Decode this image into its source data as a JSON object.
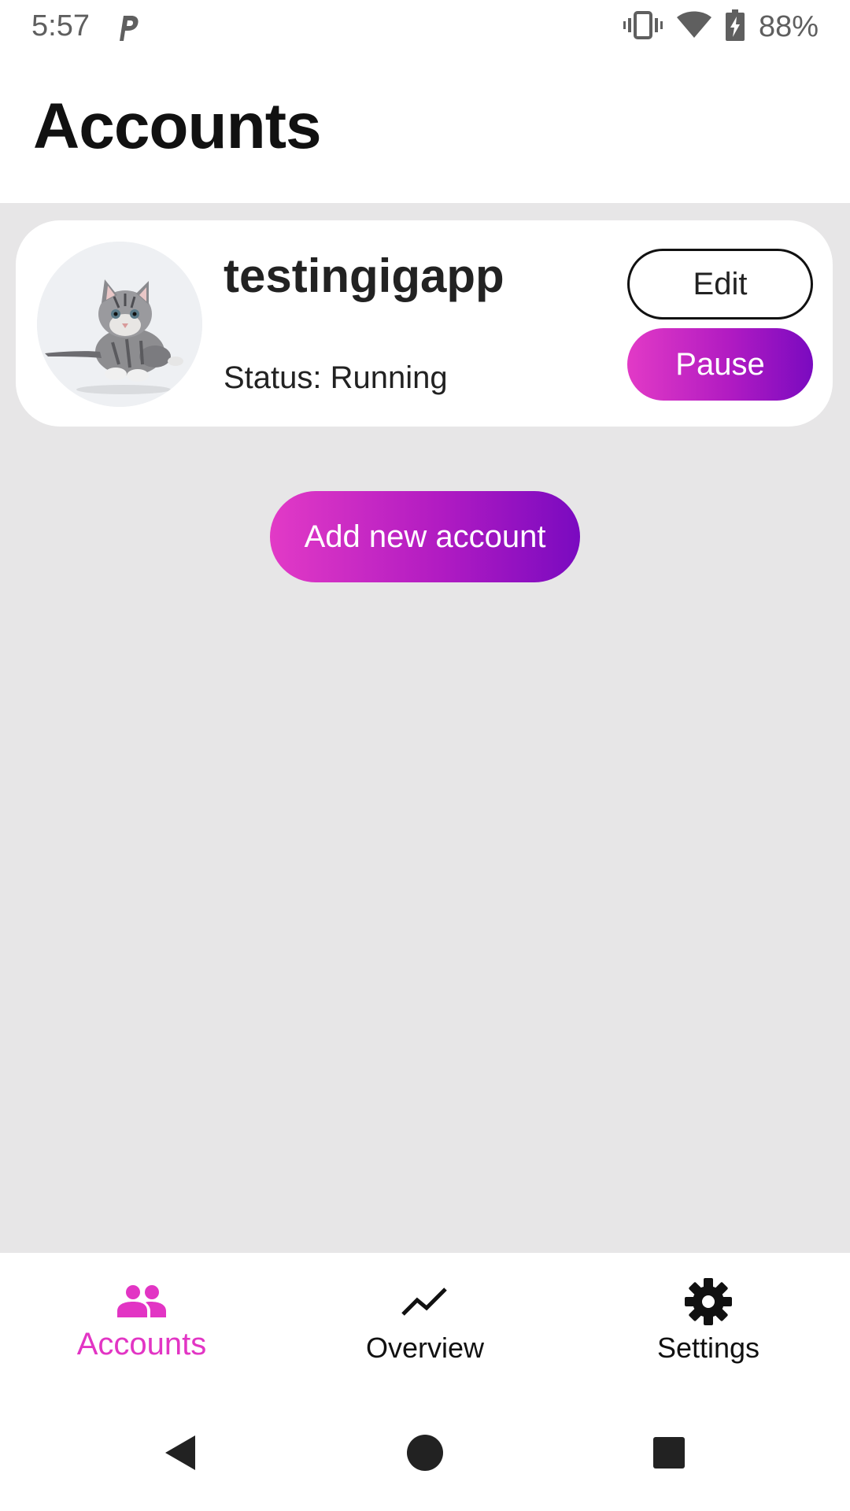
{
  "status_bar": {
    "time": "5:57",
    "app_icon": "p-icon",
    "icons": [
      "vibrate-icon",
      "wifi-icon",
      "battery-charging-icon"
    ],
    "battery_percent": "88%"
  },
  "header": {
    "title": "Accounts"
  },
  "accounts": [
    {
      "avatar": "kitten-photo",
      "username": "testingigapp",
      "status": "Status: Running",
      "edit_label": "Edit",
      "pause_label": "Pause"
    }
  ],
  "add_account_label": "Add new account",
  "bottom_nav": {
    "items": [
      {
        "label": "Accounts",
        "icon": "people-icon",
        "active": true
      },
      {
        "label": "Overview",
        "icon": "trend-line-icon",
        "active": false
      },
      {
        "label": "Settings",
        "icon": "gear-icon",
        "active": false
      }
    ]
  },
  "system_nav": {
    "icons": [
      "back-icon",
      "home-icon",
      "recents-icon"
    ]
  },
  "colors": {
    "accent_start": "#e23ac6",
    "accent_end": "#7a0ac0",
    "active_nav": "#e235c4",
    "background": "#e7e6e7"
  }
}
